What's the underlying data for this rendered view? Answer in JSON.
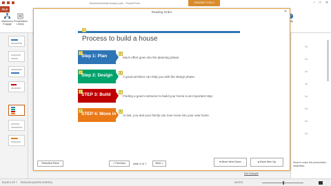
{
  "window": {
    "document_title": "BusinessDataExample.pptx - PowerPoint",
    "tool_tab": "DRAWING TOOLS"
  },
  "ribbon": {
    "file_tab": "FILE",
    "buttons": [
      {
        "label": "Markdown Engage",
        "icon": "hierarchy-icon"
      },
      {
        "label": "Presentation Library",
        "icon": "library-icon"
      }
    ],
    "right_button": "Help"
  },
  "dialog": {
    "title": "Reading Order",
    "close": "✕",
    "slide": {
      "title": "Process to build a house",
      "title_badge": "1",
      "steps": [
        {
          "badge": "2",
          "label": "Step 1: Plan",
          "color": "#2e75b6",
          "desc_badge": "3",
          "desc": "Much effort goes into the planning phase."
        },
        {
          "badge": "4",
          "label": "Step 2: Design",
          "color": "#00a36c",
          "desc_badge": "5",
          "desc": "A good architect can help you with the design phase."
        },
        {
          "badge": "6",
          "label": "STEP 3: Build",
          "color": "#c00000",
          "desc_badge": "7",
          "desc": "Finding a good contractor to build your home is an important step."
        },
        {
          "badge": "8",
          "label": "STEP 4: Move in",
          "color": "#ea7a17",
          "desc_badge": "9",
          "desc": "At last, you and your family can now move into your new home."
        }
      ]
    },
    "footer": {
      "selection_pane": "Selection Pane",
      "previous": "< Previous",
      "slide_indicator": "slide 5 of 7",
      "next": "Next >",
      "move_down": "Move Item Down",
      "move_up": "Move Item Up"
    }
  },
  "right_pane": {
    "rows": [
      "No",
      "No",
      "No",
      "No",
      "No",
      "No",
      "No",
      "No"
    ],
    "note": "Read to make this presentation disabilities."
  },
  "status": {
    "slide": "SLIDE 5 OF 7",
    "language": "ENGLISH (UNITED STATES)",
    "notes": "NOTES",
    "zoom": "—",
    "link": "See Example"
  }
}
